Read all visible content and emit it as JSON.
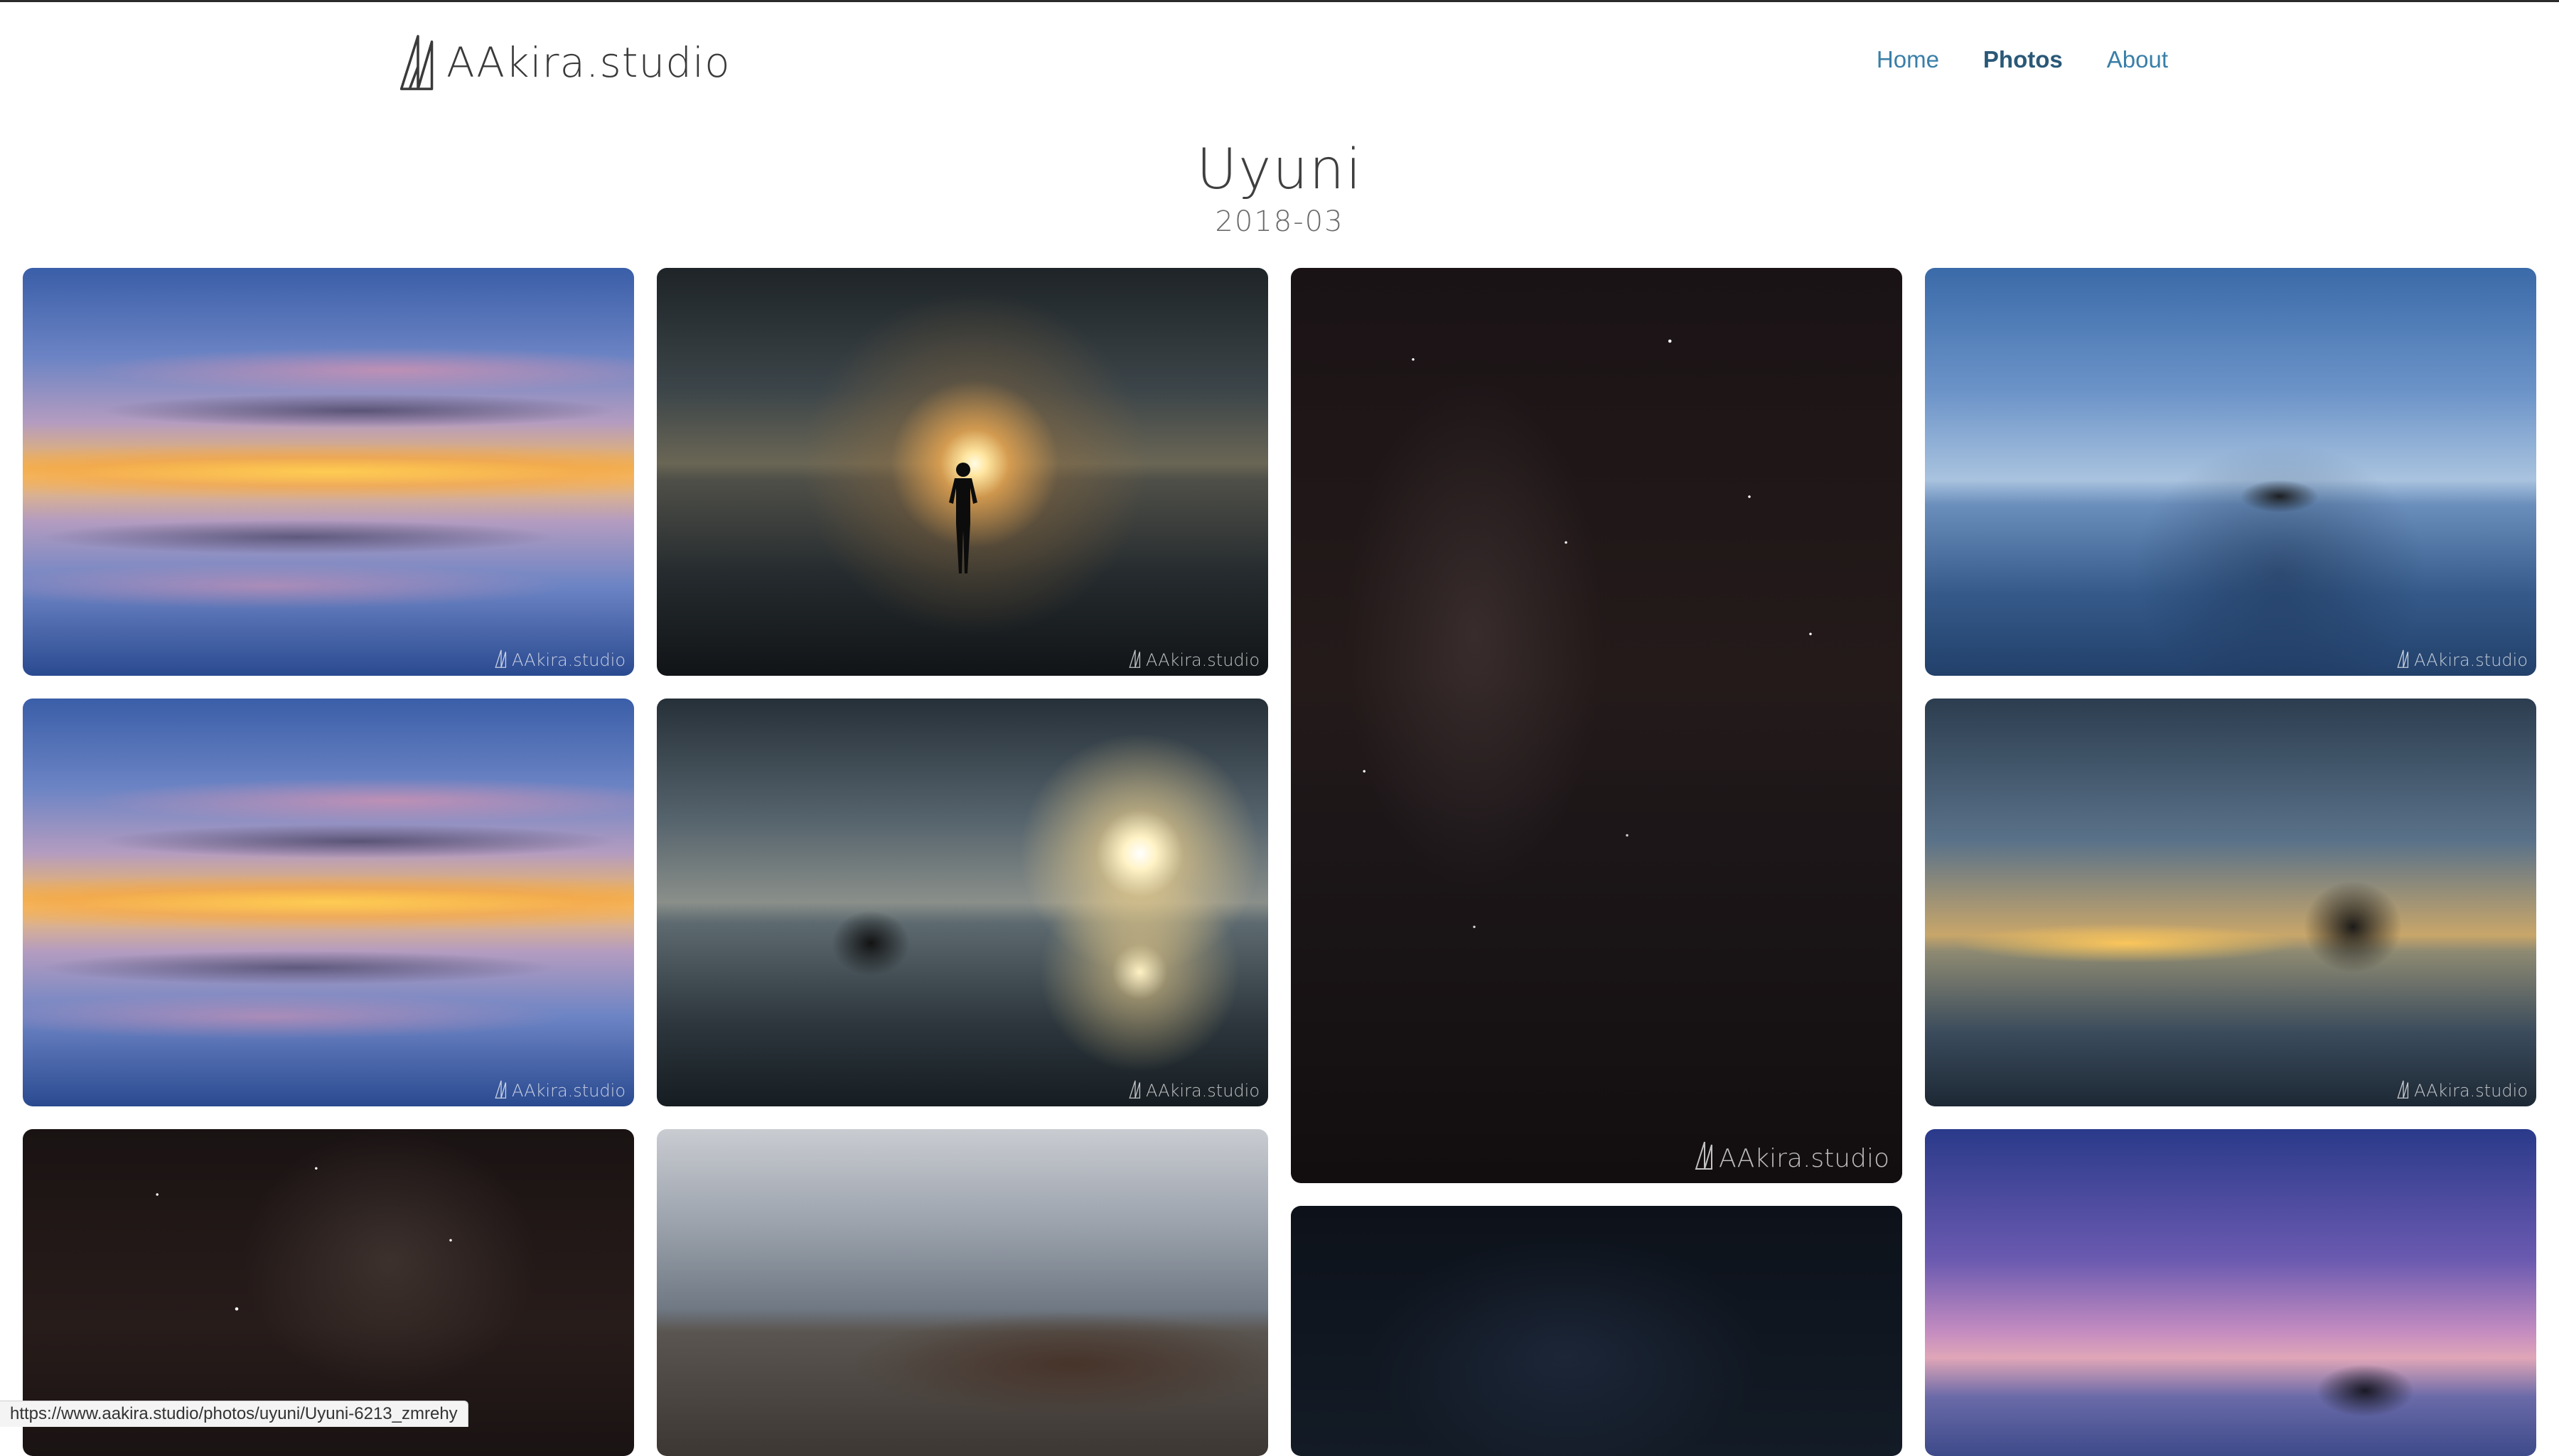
{
  "header": {
    "logo_text": "AAkira.studio",
    "nav": [
      {
        "label": "Home",
        "active": false
      },
      {
        "label": "Photos",
        "active": true
      },
      {
        "label": "About",
        "active": false
      }
    ]
  },
  "album": {
    "title": "Uyuni",
    "date": "2018-03"
  },
  "photos": [
    {
      "name": "uyuni-sunset-reflection",
      "watermark": "AAkira.studio"
    },
    {
      "name": "uyuni-moon-silhouette",
      "watermark": "AAkira.studio"
    },
    {
      "name": "uyuni-starry-night",
      "watermark": "AAkira.studio"
    },
    {
      "name": "uyuni-jeep-blue-hour",
      "watermark": "AAkira.studio"
    },
    {
      "name": "uyuni-sunset-reflection-2",
      "watermark": "AAkira.studio"
    },
    {
      "name": "uyuni-moon-jeep",
      "watermark": "AAkira.studio"
    },
    {
      "name": "uyuni-jeep-dusk",
      "watermark": "AAkira.studio"
    },
    {
      "name": "uyuni-milky-way",
      "watermark": ""
    },
    {
      "name": "uyuni-train-cemetery",
      "watermark": ""
    },
    {
      "name": "uyuni-night-sky",
      "watermark": ""
    },
    {
      "name": "uyuni-purple-dawn",
      "watermark": ""
    }
  ],
  "status_bar": {
    "url": "https://www.aakira.studio/photos/uyuni/Uyuni-6213_zmrehy"
  }
}
